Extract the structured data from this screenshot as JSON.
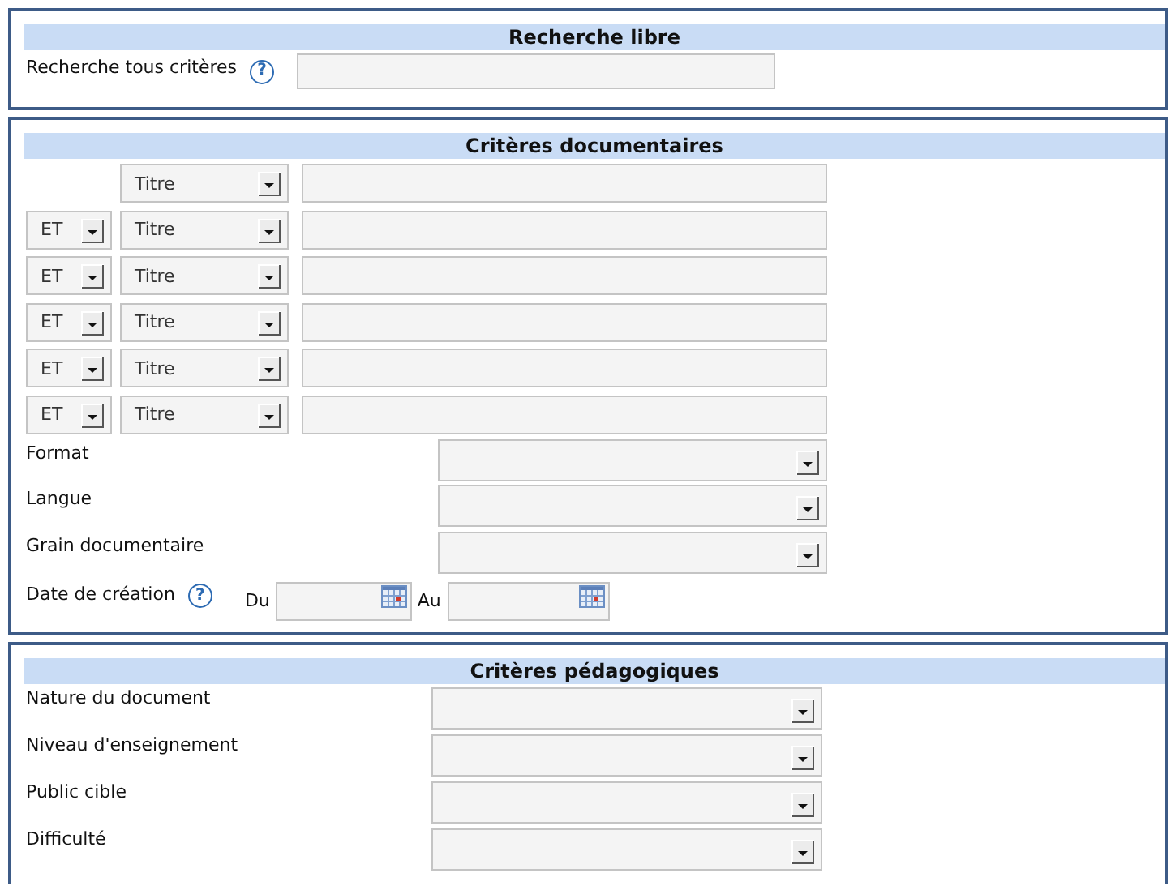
{
  "free_search": {
    "title": "Recherche libre",
    "label": "Recherche tous critères",
    "help": "?"
  },
  "documentary": {
    "title": "Critères documentaires",
    "criteria_rows": [
      {
        "field": "Titre"
      },
      {
        "operator": "ET",
        "field": "Titre"
      },
      {
        "operator": "ET",
        "field": "Titre"
      },
      {
        "operator": "ET",
        "field": "Titre"
      },
      {
        "operator": "ET",
        "field": "Titre"
      },
      {
        "operator": "ET",
        "field": "Titre"
      }
    ],
    "selects": [
      {
        "label": "Format"
      },
      {
        "label": "Langue"
      },
      {
        "label": "Grain documentaire"
      }
    ],
    "date": {
      "label": "Date de création",
      "help": "?",
      "from_label": "Du",
      "to_label": "Au"
    }
  },
  "pedagogical": {
    "title": "Critères pédagogiques",
    "selects": [
      {
        "label": "Nature du document"
      },
      {
        "label": "Niveau d'enseignement"
      },
      {
        "label": "Public cible"
      },
      {
        "label": "Difficulté"
      }
    ]
  }
}
